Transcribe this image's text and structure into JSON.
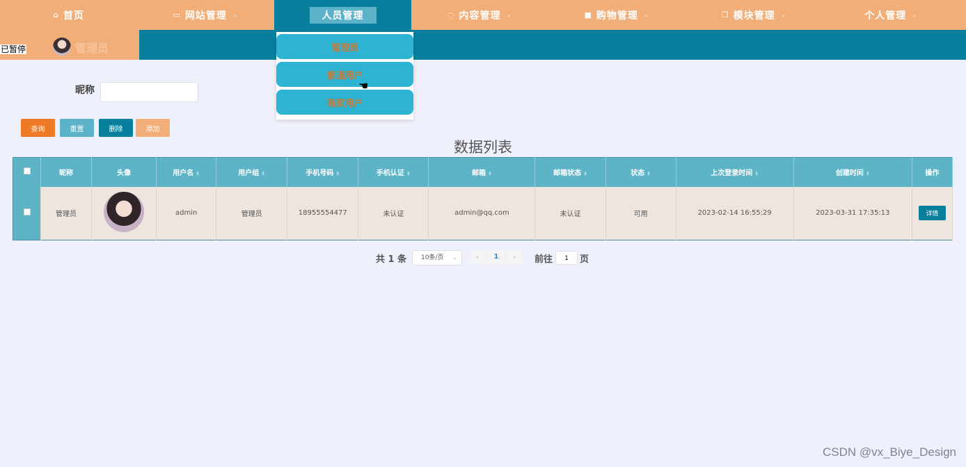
{
  "nav": {
    "items": [
      {
        "icon": "home-icon",
        "glyph": "⌂",
        "label": "首页",
        "chevron": ""
      },
      {
        "icon": "monitor-icon",
        "glyph": "▭",
        "label": "网站管理",
        "chevron": "⌄"
      },
      {
        "icon": "",
        "glyph": "",
        "label": "人员管理",
        "chevron": ""
      },
      {
        "icon": "chat-icon",
        "glyph": "◌",
        "label": "内容管理",
        "chevron": "⌄"
      },
      {
        "icon": "bag-icon",
        "glyph": "■",
        "label": "购物管理",
        "chevron": "⌄"
      },
      {
        "icon": "copy-icon",
        "glyph": "❐",
        "label": "模块管理",
        "chevron": "⌄"
      },
      {
        "icon": "",
        "glyph": "",
        "label": "个人管理",
        "chevron": "⌄"
      }
    ],
    "active_index": 2
  },
  "user": {
    "name": "管理员",
    "paused_text": "已暂停"
  },
  "dropdown": {
    "items": [
      "管理员",
      "普通用户",
      "商家用户"
    ]
  },
  "search": {
    "label": "昵称",
    "value": "",
    "placeholder": ""
  },
  "buttons": {
    "query": "查询",
    "reset": "重置",
    "delete": "删除",
    "add": "添加"
  },
  "colors": {
    "nav_bg": "#f2ae78",
    "primary": "#087f9c",
    "orange": "#ef7a25",
    "teal": "#5db4c6",
    "row_bg": "#eee5de"
  },
  "list_title": "数据列表",
  "table": {
    "headers": [
      "昵称",
      "头像",
      "用户名",
      "用户组",
      "手机号码",
      "手机认证",
      "邮箱",
      "邮箱状态",
      "状态",
      "上次登录时间",
      "创建时间",
      "操作"
    ],
    "sortable": [
      false,
      false,
      true,
      true,
      true,
      true,
      true,
      true,
      true,
      true,
      true,
      false
    ],
    "rows": [
      {
        "nickname": "管理员",
        "username": "admin",
        "group": "管理员",
        "phone": "18955554477",
        "phone_verify": "未认证",
        "email": "admin@qq.com",
        "email_status": "未认证",
        "status": "可用",
        "last_login": "2023-02-14 16:55:29",
        "created": "2023-03-31 17:35:13",
        "action": "详情"
      }
    ]
  },
  "pager": {
    "total": "共 1 条",
    "page_size": "10条/页",
    "current": "1",
    "goto_label": "前往",
    "goto_value": "1",
    "unit": "页"
  },
  "watermark": "CSDN @vx_Biye_Design"
}
